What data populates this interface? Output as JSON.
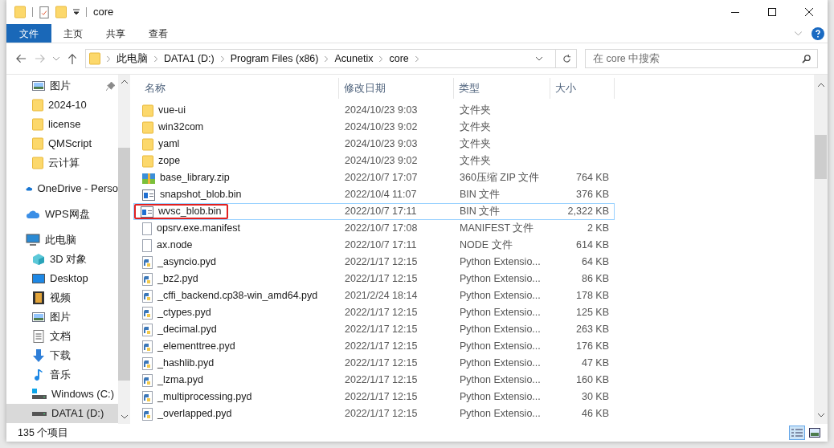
{
  "window": {
    "title": "core"
  },
  "ribbon_tabs": [
    {
      "label": "文件",
      "selected": true
    },
    {
      "label": "主页",
      "selected": false
    },
    {
      "label": "共享",
      "selected": false
    },
    {
      "label": "查看",
      "selected": false
    }
  ],
  "breadcrumb": [
    "此电脑",
    "DATA1 (D:)",
    "Program Files (x86)",
    "Acunetix",
    "core"
  ],
  "search": {
    "placeholder": "在 core 中搜索"
  },
  "sidebar": {
    "items": [
      {
        "label": "图片",
        "kind": "picture",
        "pinned": true,
        "selected": false
      },
      {
        "label": "2024-10",
        "kind": "folder",
        "pinned": false,
        "selected": false
      },
      {
        "label": "license",
        "kind": "folder",
        "pinned": false,
        "selected": false
      },
      {
        "label": "QMScript",
        "kind": "folder",
        "pinned": false,
        "selected": false
      },
      {
        "label": "云计算",
        "kind": "folder",
        "pinned": false,
        "selected": false
      },
      {
        "label": "OneDrive - Perso",
        "kind": "cloud",
        "pinned": false,
        "selected": false
      },
      {
        "label": "WPS网盘",
        "kind": "cloud2",
        "pinned": false,
        "selected": false
      },
      {
        "label": "此电脑",
        "kind": "pc",
        "pinned": false,
        "selected": false,
        "children": [
          {
            "label": "3D 对象",
            "kind": "cube",
            "pinned": false,
            "selected": false
          },
          {
            "label": "Desktop",
            "kind": "desktop",
            "pinned": false,
            "selected": false
          },
          {
            "label": "视频",
            "kind": "video",
            "pinned": false,
            "selected": false
          },
          {
            "label": "图片",
            "kind": "picture",
            "pinned": false,
            "selected": false
          },
          {
            "label": "文档",
            "kind": "doc",
            "pinned": false,
            "selected": false
          },
          {
            "label": "下载",
            "kind": "download",
            "pinned": false,
            "selected": false
          },
          {
            "label": "音乐",
            "kind": "music",
            "pinned": false,
            "selected": false
          },
          {
            "label": "Windows (C:)",
            "kind": "windrive",
            "pinned": false,
            "selected": false
          },
          {
            "label": "DATA1 (D:)",
            "kind": "drive",
            "pinned": false,
            "selected": true
          }
        ]
      }
    ]
  },
  "table": {
    "columns": [
      "名称",
      "修改日期",
      "类型",
      "大小"
    ],
    "rows": [
      {
        "kind": "folder",
        "name": "vue-ui",
        "date": "2024/10/23 9:03",
        "type": "文件夹",
        "focused": false,
        "marked": false
      },
      {
        "kind": "folder",
        "name": "win32com",
        "date": "2024/10/23 9:02",
        "type": "文件夹",
        "focused": false,
        "marked": false
      },
      {
        "kind": "folder",
        "name": "yaml",
        "date": "2024/10/23 9:03",
        "type": "文件夹",
        "focused": false,
        "marked": false
      },
      {
        "kind": "folder",
        "name": "zope",
        "date": "2024/10/23 9:02",
        "type": "文件夹",
        "focused": false,
        "marked": false
      },
      {
        "kind": "zip",
        "name": "base_library.zip",
        "date": "2022/10/7 17:07",
        "type": "360压缩 ZIP 文件",
        "size": "764 KB",
        "focused": false,
        "marked": false
      },
      {
        "kind": "bin",
        "name": "snapshot_blob.bin",
        "date": "2022/10/4 11:07",
        "type": "BIN 文件",
        "size": "376 KB",
        "focused": false,
        "marked": false
      },
      {
        "kind": "bin",
        "name": "wvsc_blob.bin",
        "date": "2022/10/7 17:11",
        "type": "BIN 文件",
        "size": "2,322 KB",
        "focused": true,
        "marked": true
      },
      {
        "kind": "file",
        "name": "opsrv.exe.manifest",
        "date": "2022/10/7 17:08",
        "type": "MANIFEST 文件",
        "size": "2 KB",
        "focused": false,
        "marked": false
      },
      {
        "kind": "file",
        "name": "ax.node",
        "date": "2022/10/7 17:11",
        "type": "NODE 文件",
        "size": "614 KB",
        "focused": false,
        "marked": false
      },
      {
        "kind": "python",
        "name": "_asyncio.pyd",
        "date": "2022/1/17 12:15",
        "type": "Python Extensio...",
        "size": "64 KB",
        "focused": false,
        "marked": false
      },
      {
        "kind": "python",
        "name": "_bz2.pyd",
        "date": "2022/1/17 12:15",
        "type": "Python Extensio...",
        "size": "86 KB",
        "focused": false,
        "marked": false
      },
      {
        "kind": "python",
        "name": "_cffi_backend.cp38-win_amd64.pyd",
        "date": "2021/2/24 18:14",
        "type": "Python Extensio...",
        "size": "178 KB",
        "focused": false,
        "marked": false
      },
      {
        "kind": "python",
        "name": "_ctypes.pyd",
        "date": "2022/1/17 12:15",
        "type": "Python Extensio...",
        "size": "125 KB",
        "focused": false,
        "marked": false
      },
      {
        "kind": "python",
        "name": "_decimal.pyd",
        "date": "2022/1/17 12:15",
        "type": "Python Extensio...",
        "size": "263 KB",
        "focused": false,
        "marked": false
      },
      {
        "kind": "python",
        "name": "_elementtree.pyd",
        "date": "2022/1/17 12:15",
        "type": "Python Extensio...",
        "size": "176 KB",
        "focused": false,
        "marked": false
      },
      {
        "kind": "python",
        "name": "_hashlib.pyd",
        "date": "2022/1/17 12:15",
        "type": "Python Extensio...",
        "size": "47 KB",
        "focused": false,
        "marked": false
      },
      {
        "kind": "python",
        "name": "_lzma.pyd",
        "date": "2022/1/17 12:15",
        "type": "Python Extensio...",
        "size": "160 KB",
        "focused": false,
        "marked": false
      },
      {
        "kind": "python",
        "name": "_multiprocessing.pyd",
        "date": "2022/1/17 12:15",
        "type": "Python Extensio...",
        "size": "30 KB",
        "focused": false,
        "marked": false
      },
      {
        "kind": "python",
        "name": "_overlapped.pyd",
        "date": "2022/1/17 12:15",
        "type": "Python Extensio...",
        "size": "46 KB",
        "focused": false,
        "marked": false
      }
    ]
  },
  "status_bar": {
    "count": "135 个项目",
    "view_modes": [
      {
        "kind": "details",
        "selected": true
      },
      {
        "kind": "tiles",
        "selected": false
      }
    ]
  }
}
